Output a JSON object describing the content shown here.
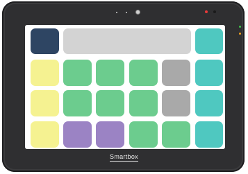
{
  "device": {
    "brand": "Smartbox",
    "frame_color": "#2f2f31",
    "status_lights": [
      "#e83a3a",
      "#1a1a1a",
      "#3fc24a",
      "#f0a020"
    ]
  },
  "colors": {
    "navy": "#2e4563",
    "gray_bar": "#d3d3d3",
    "teal": "#4fc8c0",
    "yellow": "#f5f291",
    "green": "#6ccc8e",
    "gray": "#a9a9a9",
    "purple": "#9b83c4"
  },
  "grid": {
    "rows": [
      [
        "navy",
        "gray_bar",
        "teal"
      ],
      [
        "yellow",
        "green",
        "green",
        "green",
        "gray",
        "teal"
      ],
      [
        "yellow",
        "green",
        "green",
        "green",
        "gray",
        "teal"
      ],
      [
        "yellow",
        "purple",
        "purple",
        "green",
        "green",
        "teal"
      ]
    ]
  }
}
